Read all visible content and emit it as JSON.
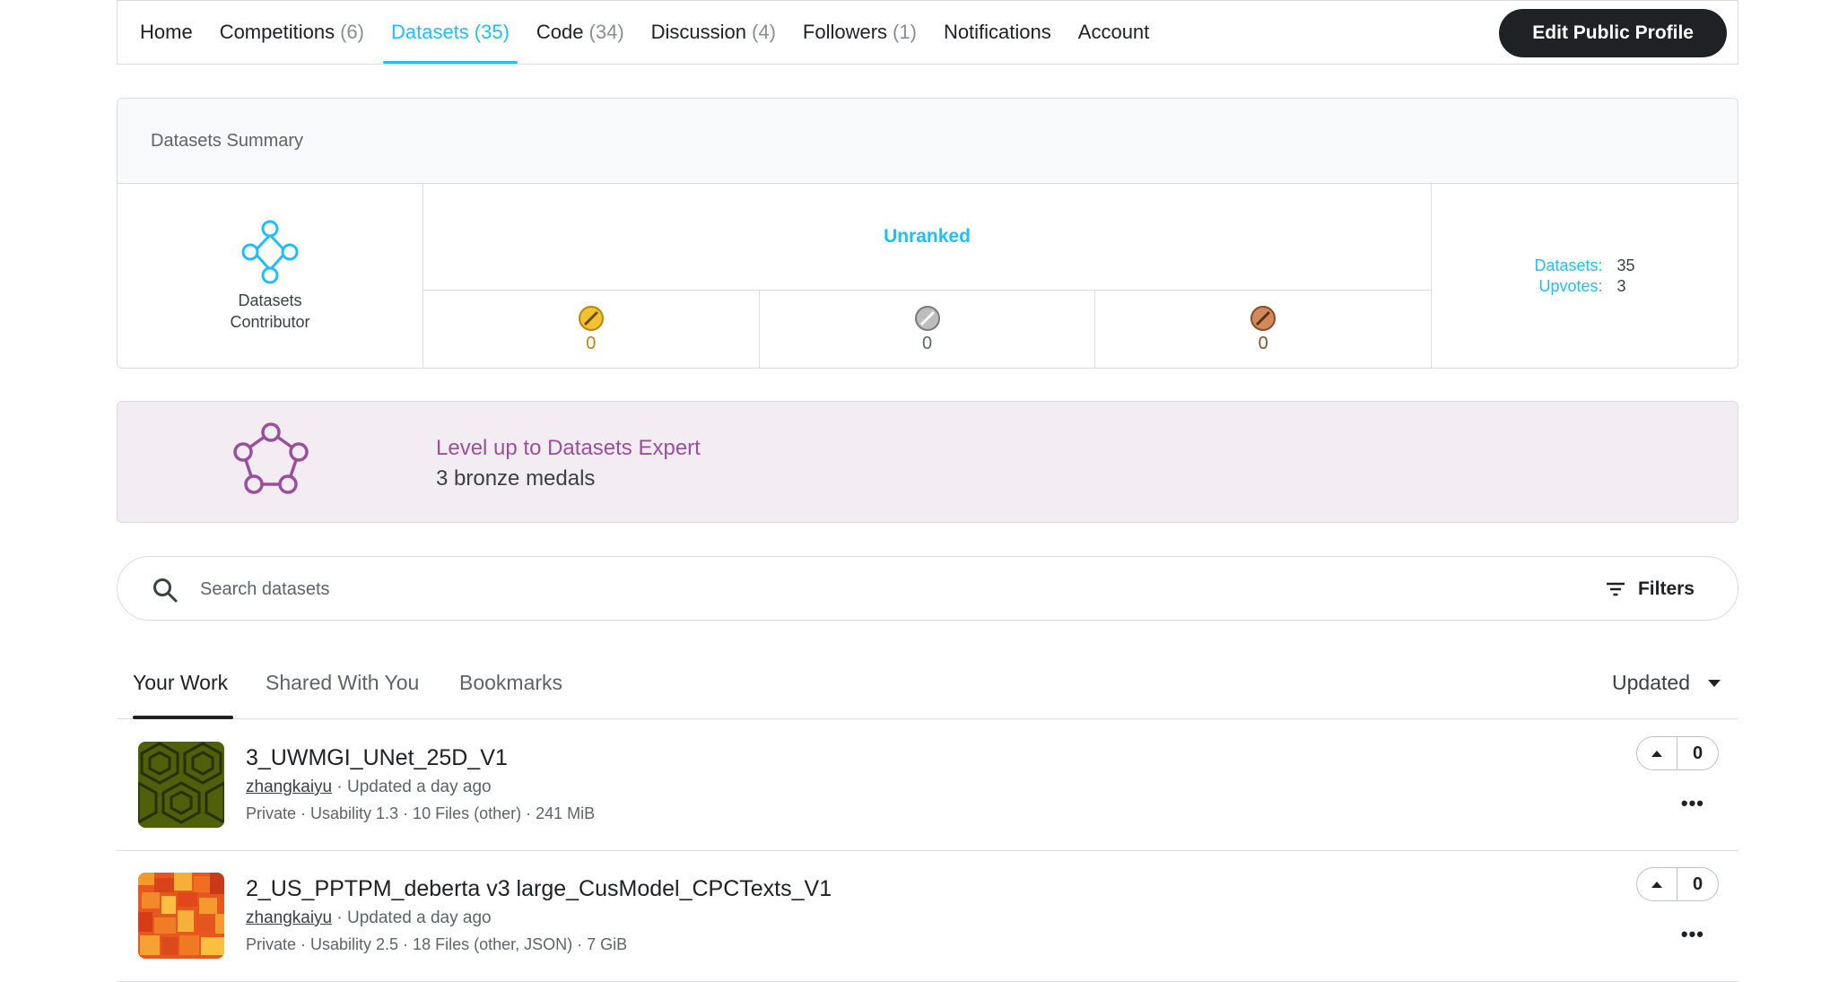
{
  "nav": {
    "tabs": [
      {
        "label": "Home",
        "count": ""
      },
      {
        "label": "Competitions",
        "count": "(6)"
      },
      {
        "label": "Datasets",
        "count": "(35)"
      },
      {
        "label": "Code",
        "count": "(34)"
      },
      {
        "label": "Discussion",
        "count": "(4)"
      },
      {
        "label": "Followers",
        "count": "(1)"
      },
      {
        "label": "Notifications",
        "count": ""
      },
      {
        "label": "Account",
        "count": ""
      }
    ],
    "active_tab": "Datasets",
    "edit_button": "Edit Public Profile"
  },
  "summary": {
    "heading": "Datasets Summary",
    "tier_label_line1": "Datasets",
    "tier_label_line2": "Contributor",
    "rank": "Unranked",
    "medals": {
      "gold": "0",
      "silver": "0",
      "bronze": "0"
    },
    "stats": {
      "datasets_key": "Datasets:",
      "datasets_val": "35",
      "upvotes_key": "Upvotes:",
      "upvotes_val": "3"
    }
  },
  "levelup": {
    "title": "Level up to Datasets Expert",
    "subtitle": "3 bronze medals"
  },
  "search": {
    "placeholder": "Search datasets",
    "filters_label": "Filters"
  },
  "subtabs": {
    "your_work": "Your Work",
    "shared": "Shared With You",
    "bookmarks": "Bookmarks",
    "sort": "Updated"
  },
  "datasets": [
    {
      "title": "3_UWMGI_UNet_25D_V1",
      "owner": "zhangkaiyu",
      "updated": " · Updated a day ago",
      "info": "Private · Usability 1.3 · 10 Files (other) · 241 MiB",
      "votes": "0"
    },
    {
      "title": "2_US_PPTPM_deberta v3 large_CusModel_CPCTexts_V1",
      "owner": "zhangkaiyu",
      "updated": " · Updated a day ago",
      "info": "Private · Usability 2.5 · 18 Files (other, JSON) · 7 GiB",
      "votes": "0"
    }
  ],
  "colors": {
    "accent": "#20beff",
    "dark": "#202124",
    "levelup_bg": "#f3ecf3",
    "levelup_text": "#9a4f9c",
    "gold": "#e8b32b",
    "silver": "#8a8d91",
    "bronze": "#c27a4d"
  },
  "icons": [
    "datasets-contributor-icon",
    "datasets-expert-icon",
    "search-icon",
    "filter-icon",
    "chevron-down-icon",
    "upvote-arrow-icon",
    "more-options-icon",
    "gold-medal-icon",
    "silver-medal-icon",
    "bronze-medal-icon"
  ]
}
